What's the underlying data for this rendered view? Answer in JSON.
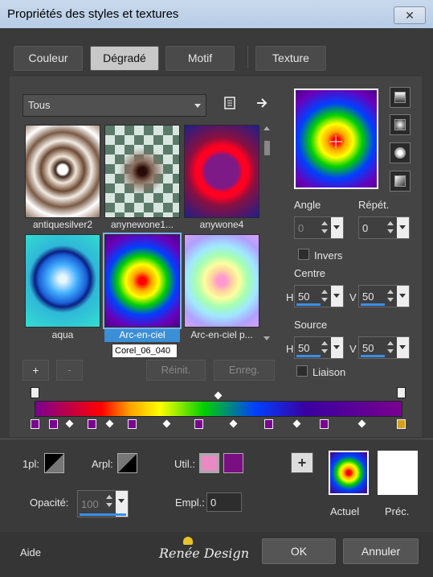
{
  "window": {
    "title": "Propriétés des styles et textures",
    "close_label": "✕"
  },
  "tabs": [
    {
      "label": "Couleur",
      "active": false
    },
    {
      "label": "Dégradé",
      "active": true
    },
    {
      "label": "Motif",
      "active": false
    },
    {
      "label": "Texture",
      "active": false
    }
  ],
  "filter": {
    "value": "Tous"
  },
  "thumbnails": [
    {
      "label": "antiquesilver2",
      "selected": false
    },
    {
      "label": "anynewone1...",
      "selected": false
    },
    {
      "label": "anywone4",
      "selected": false
    },
    {
      "label": "aqua",
      "selected": false
    },
    {
      "label": "Arc-en-ciel",
      "selected": true
    },
    {
      "label": "Arc-en-ciel p...",
      "selected": false
    }
  ],
  "tooltip": "Corel_06_040",
  "list_buttons": {
    "add": "+",
    "remove": "-",
    "reset": "Réinit.",
    "save": "Enreg."
  },
  "angle": {
    "label": "Angle",
    "value": "0"
  },
  "repeat": {
    "label": "Répét.",
    "value": "0"
  },
  "invert": {
    "label": "Invers",
    "checked": false
  },
  "centre": {
    "label": "Centre",
    "h_label": "H",
    "h_value": "50",
    "v_label": "V",
    "v_value": "50"
  },
  "source": {
    "label": "Source",
    "h_label": "H",
    "h_value": "50",
    "v_label": "V",
    "v_value": "50"
  },
  "link": {
    "label": "Liaison",
    "checked": false
  },
  "bottom": {
    "plan1_label": "1pl:",
    "arpl_label": "Arpl:",
    "util_label": "Util.:",
    "opacity_label": "Opacité:",
    "opacity_value": "100",
    "empl_label": "Empl.:",
    "empl_value": "0",
    "add_label": "+",
    "current_label": "Actuel",
    "previous_label": "Préc.",
    "util_colors": [
      "#e88bc4",
      "#7a0f83"
    ]
  },
  "footer": {
    "help": "Aide",
    "brand": "Renée Design",
    "ok": "OK",
    "cancel": "Annuler"
  },
  "colors": {
    "accent": "#3b8fd6",
    "panel": "#444444",
    "background": "#3a3a3a"
  },
  "icons": [
    "close-icon",
    "chevron-down-icon",
    "book-icon",
    "arrow-right-icon",
    "gradient-linear-icon",
    "gradient-rectangular-icon",
    "gradient-sunburst-icon",
    "gradient-corner-icon",
    "plus-icon",
    "butterfly-logo-icon"
  ]
}
